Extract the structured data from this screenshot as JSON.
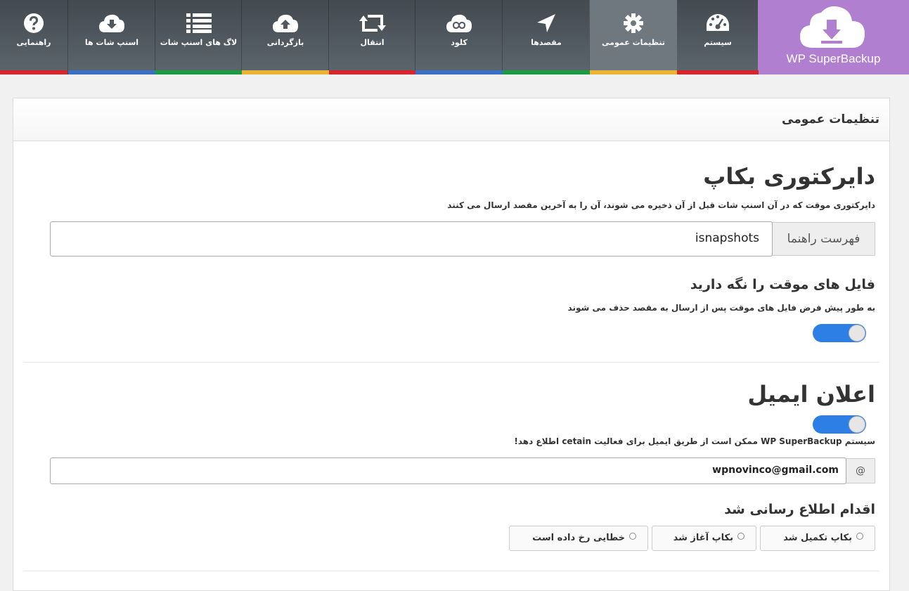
{
  "brand": {
    "name": "WP SuperBackup",
    "color": "#b17fcf"
  },
  "nav": [
    {
      "label": "سیستم",
      "icon": "dashboard-icon",
      "bar": "#d9262d"
    },
    {
      "label": "تنظیمات عمومی",
      "icon": "gear-icon",
      "bar": "#e8b433",
      "active": true
    },
    {
      "label": "مقصدها",
      "icon": "location-arrow-icon",
      "bar": "#1e9a45"
    },
    {
      "label": "کلود",
      "icon": "cloud-link-icon",
      "bar": "#3a6fc4"
    },
    {
      "label": "انتقال",
      "icon": "retweet-icon",
      "bar": "#d9262d"
    },
    {
      "label": "بازگردانی",
      "icon": "cloud-upload-icon",
      "bar": "#e8b433"
    },
    {
      "label": "لاگ های اسنپ شات",
      "icon": "list-icon",
      "bar": "#1e9a45"
    },
    {
      "label": "اسنپ شات ها",
      "icon": "cloud-download-icon",
      "bar": "#3a6fc4"
    },
    {
      "label": "راهنمایی",
      "icon": "question-circle-icon",
      "bar": "#d9262d"
    }
  ],
  "panel": {
    "title": "تنظیمات عمومی"
  },
  "backup_dir": {
    "heading": "دایرکتوری بکاپ",
    "description": "دایرکتوری موقت که در آن اسنپ شات قبل از آن ذخیره می شوند، آن را به آخرین مقصد ارسال می کنند",
    "addon_label": "فهرست راهنما",
    "value": "isnapshots"
  },
  "keep_temp": {
    "heading": "فایل های موقت را نگه دارید",
    "description": "به طور پیش فرض فایل های موقت پس از ارسال به مقصد حذف می شوند",
    "enabled": true
  },
  "email": {
    "heading": "اعلان ایمیل",
    "enabled": true,
    "description": "سیستم WP SuperBackup ممکن است از طریق ایمیل برای فعالیت cetain اطلاع دهد!",
    "addon_symbol": "@",
    "value": "wpnovinco@gmail.com"
  },
  "notify": {
    "heading": "اقدام اطلاع رسانی شد",
    "options": [
      "بکاپ تکمیل شد",
      "بکاپ آغاز شد",
      "خطایی رخ داده است"
    ]
  },
  "colors": {
    "toggle_on": "#2d7fe6",
    "nav_dark": "#434a50"
  }
}
